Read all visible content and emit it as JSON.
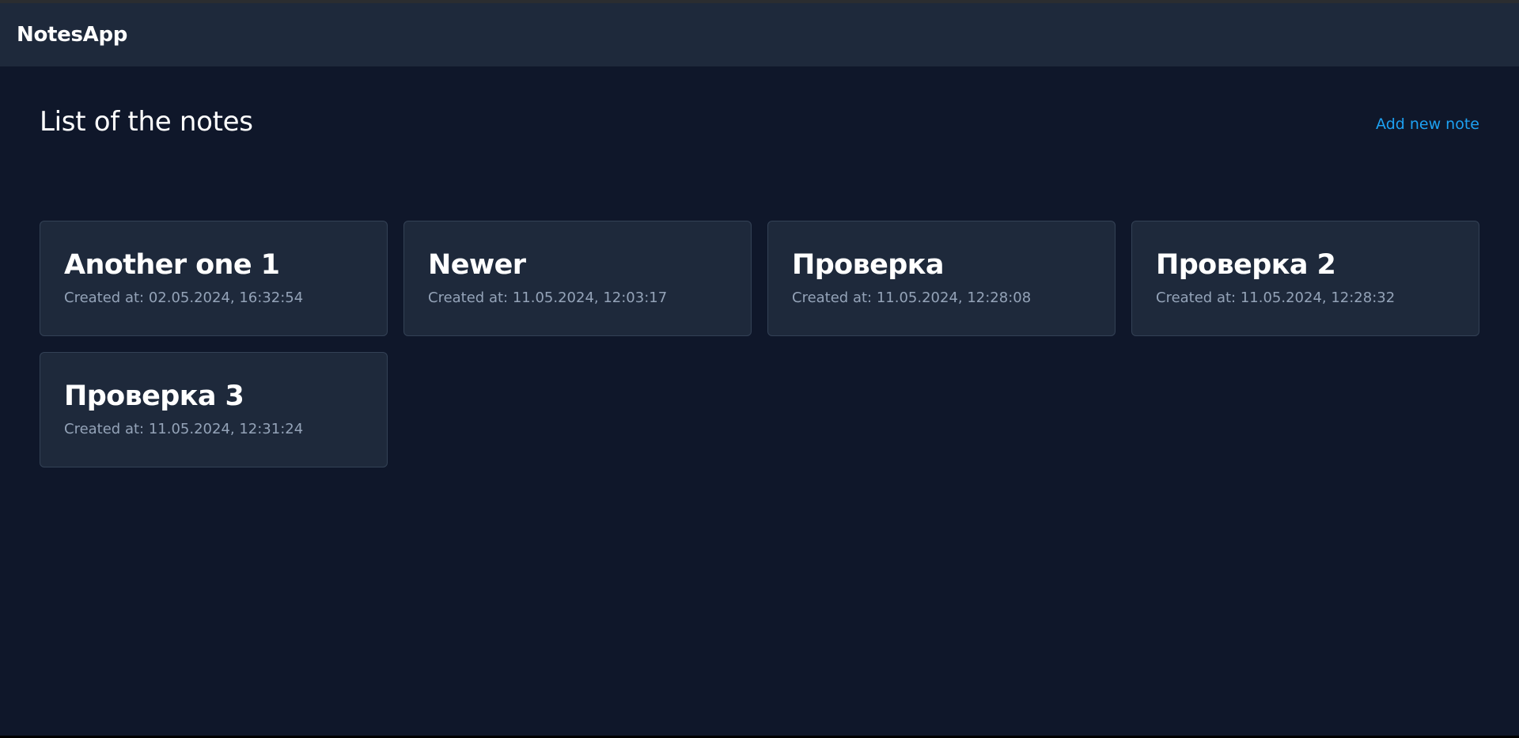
{
  "navbar": {
    "brand": "NotesApp"
  },
  "main": {
    "title": "List of the notes",
    "add_link": "Add new note"
  },
  "notes": [
    {
      "title": "Another one 1",
      "created": "Created at: 02.05.2024, 16:32:54"
    },
    {
      "title": "Newer",
      "created": "Created at: 11.05.2024, 12:03:17"
    },
    {
      "title": "Проверка",
      "created": "Created at: 11.05.2024, 12:28:08"
    },
    {
      "title": "Проверка 2",
      "created": "Created at: 11.05.2024, 12:28:32"
    },
    {
      "title": "Проверка 3",
      "created": "Created at: 11.05.2024, 12:31:24"
    }
  ],
  "colors": {
    "background": "#0f172a",
    "surface": "#1e293b",
    "border": "#334155",
    "link": "#1da1f2",
    "muted_text": "#94a3b8"
  }
}
